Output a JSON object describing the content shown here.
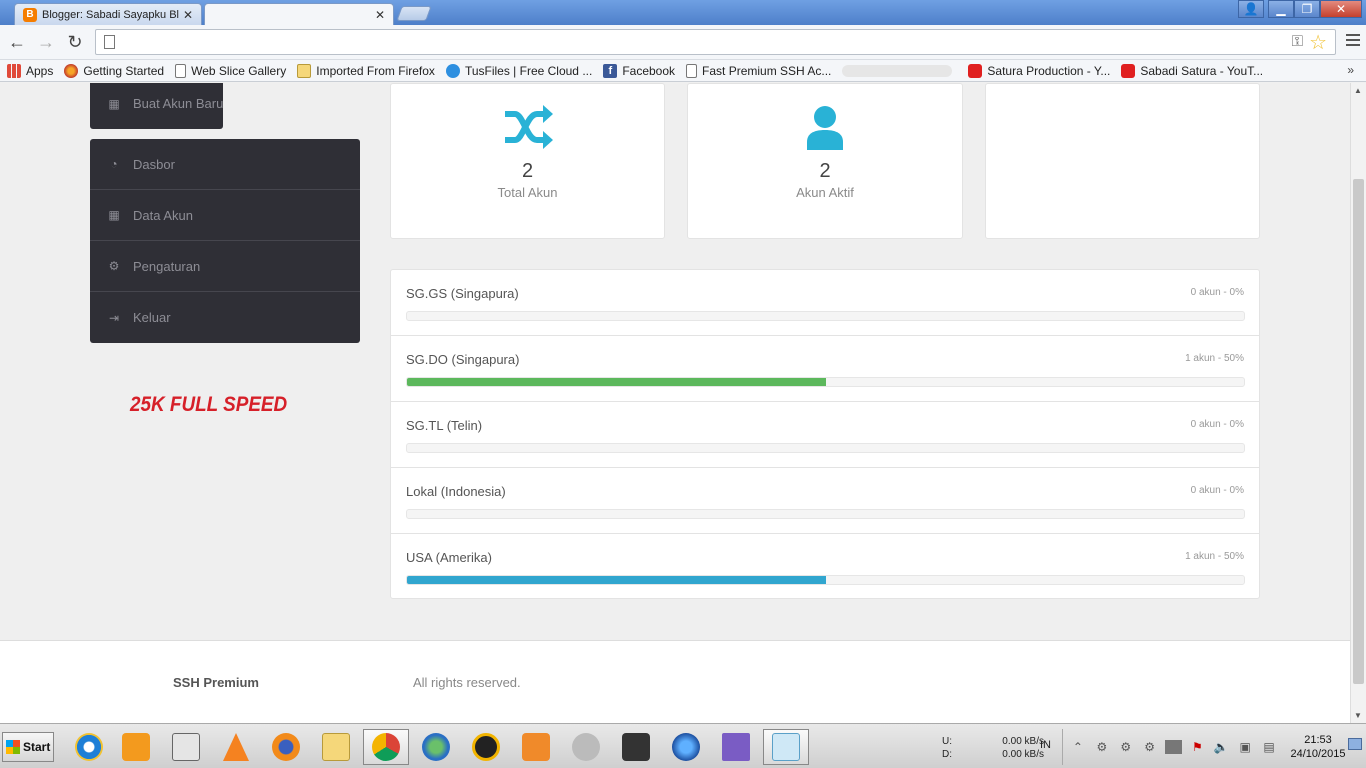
{
  "browser": {
    "tabs": [
      {
        "title": "Blogger: Sabadi Sayapku Blc",
        "icon": "blogger-icon",
        "active": false
      },
      {
        "title": "",
        "icon": "",
        "active": true
      }
    ],
    "url": "",
    "bookmarks": [
      {
        "label": "Apps",
        "icon": "apps-icon"
      },
      {
        "label": "Getting Started",
        "icon": "firefox-icon"
      },
      {
        "label": "Web Slice Gallery",
        "icon": "page-icon"
      },
      {
        "label": "Imported From Firefox",
        "icon": "folder-icon"
      },
      {
        "label": "TusFiles | Free Cloud ...",
        "icon": "download-icon"
      },
      {
        "label": "Facebook",
        "icon": "facebook-icon"
      },
      {
        "label": "Fast Premium SSH Ac...",
        "icon": "page-icon"
      },
      {
        "label": "",
        "icon": "blurred"
      },
      {
        "label": "Satura Production - Y...",
        "icon": "youtube-icon"
      },
      {
        "label": "Sabadi Satura - YouT...",
        "icon": "youtube-icon"
      }
    ],
    "overflow": "»"
  },
  "sidebar": {
    "top_items": [
      {
        "label": "Buat Akun Baru",
        "icon": "new-account-icon"
      }
    ],
    "items": [
      {
        "label": "Dasbor",
        "icon": "dashboard-icon"
      },
      {
        "label": "Data Akun",
        "icon": "table-icon"
      },
      {
        "label": "Pengaturan",
        "icon": "gear-icon"
      },
      {
        "label": "Keluar",
        "icon": "logout-icon"
      }
    ],
    "promo": "25K FULL SPEED"
  },
  "stats": [
    {
      "value": "2",
      "label": "Total Akun",
      "icon": "shuffle-icon"
    },
    {
      "value": "2",
      "label": "Akun Aktif",
      "icon": "user-icon"
    },
    {
      "value": "",
      "label": "",
      "icon": ""
    }
  ],
  "servers": [
    {
      "name": "SG.GS (Singapura)",
      "status": "0 akun - 0%",
      "percent": 0,
      "color": "#5cb85c"
    },
    {
      "name": "SG.DO (Singapura)",
      "status": "1 akun - 50%",
      "percent": 50,
      "color": "#5cb85c"
    },
    {
      "name": "SG.TL (Telin)",
      "status": "0 akun - 0%",
      "percent": 0,
      "color": "#5cb85c"
    },
    {
      "name": "Lokal (Indonesia)",
      "status": "0 akun - 0%",
      "percent": 0,
      "color": "#5cb85c"
    },
    {
      "name": "USA (Amerika)",
      "status": "1 akun - 50%",
      "percent": 50,
      "color": "#31a6cf"
    }
  ],
  "footer": {
    "brand": "SSH Premium",
    "rights": "All rights reserved."
  },
  "colors": {
    "accent": "#29b2d6",
    "sidebar_bg": "#2f2f36",
    "promo": "#d62029"
  },
  "taskbar": {
    "start": "Start",
    "net_up_label": "U:",
    "net_down_label": "D:",
    "net_up": "0.00 kB/s",
    "net_down": "0.00 kB/s",
    "lang": "IN",
    "time": "21:53",
    "date": "24/10/2015"
  }
}
